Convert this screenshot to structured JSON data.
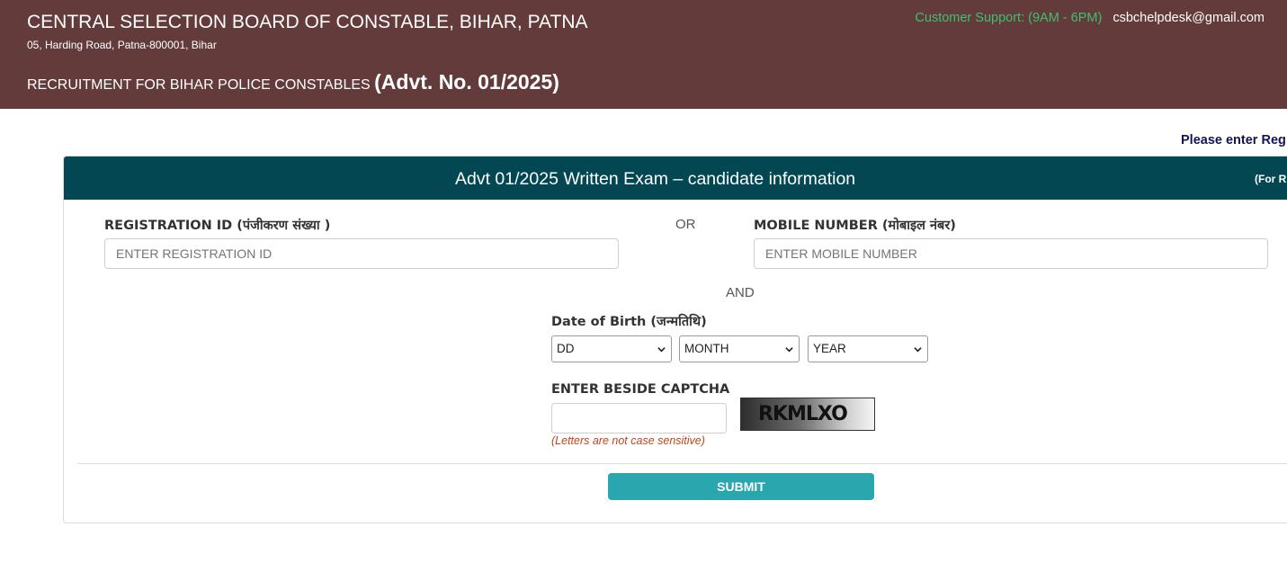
{
  "header": {
    "org_title": "CENTRAL SELECTION BOARD OF CONSTABLE, BIHAR, PATNA",
    "address": "05, Harding Road, Patna-800001, Bihar",
    "recruitment_text": "RECRUITMENT FOR BIHAR POLICE CONSTABLES",
    "advt_number": "(Advt. No. 01/2025)",
    "support_label": "Customer Support: (9AM - 6PM)",
    "support_email": "csbchelpdesk@gmail.com"
  },
  "notice": "Please enter Reg",
  "form": {
    "title": "Advt 01/2025 Written Exam – candidate information",
    "header_note": "(For R",
    "registration_label": "REGISTRATION ID (पंजीकरण संख्या )",
    "registration_placeholder": "ENTER REGISTRATION ID",
    "or_text": "OR",
    "mobile_label": "MOBILE NUMBER (मोबाइल नंबर)",
    "mobile_placeholder": "ENTER MOBILE NUMBER",
    "and_text": "AND",
    "dob_label": "Date of Birth (जन्मतिथि)",
    "dob_day": "DD",
    "dob_month": "MONTH",
    "dob_year": "YEAR",
    "captcha_label": "ENTER BESIDE CAPTCHA",
    "captcha_value": "",
    "captcha_text": "RKMLXO",
    "captcha_hint": "(Letters are not case sensitive)",
    "submit_label": "SUBMIT"
  },
  "colors": {
    "header_bg": "#643b3b",
    "card_header_bg": "#024752",
    "submit_bg": "#2aa6ae",
    "support_label": "#3fbf6f",
    "hint": "#c0441a"
  }
}
